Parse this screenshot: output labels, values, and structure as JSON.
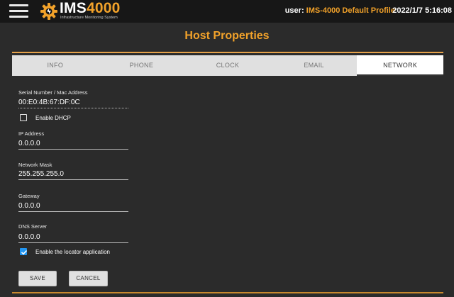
{
  "header": {
    "logo_brand": "IMS",
    "logo_number": "4000",
    "logo_subtitle": "Infrastructure Monitoring System",
    "user_label": "user:",
    "user_value": "IMS-4000 Default Profile",
    "datetime": "2022/1/7 5:16:08",
    "brand_color": "#f2a22a"
  },
  "page": {
    "title": "Host Properties"
  },
  "tabs": [
    {
      "label": "INFO",
      "active": false
    },
    {
      "label": "PHONE",
      "active": false
    },
    {
      "label": "CLOCK",
      "active": false
    },
    {
      "label": "EMAIL",
      "active": false
    },
    {
      "label": "NETWORK",
      "active": true
    }
  ],
  "form": {
    "serial": {
      "label": "Serial Number / Mac Address",
      "value": "00:E0:4B:67:DF:0C"
    },
    "dhcp": {
      "label": "Enable DHCP",
      "checked": false
    },
    "ip": {
      "label": "IP Address",
      "value": "0.0.0.0"
    },
    "mask": {
      "label": "Network Mask",
      "value": "255.255.255.0"
    },
    "gateway": {
      "label": "Gateway",
      "value": "0.0.0.0"
    },
    "dns": {
      "label": "DNS Server",
      "value": "0.0.0.0"
    },
    "locator": {
      "label": "Enable the locator application",
      "checked": true
    }
  },
  "buttons": {
    "save": "SAVE",
    "cancel": "CANCEL"
  },
  "icons": {
    "menu": "hamburger-menu-icon",
    "logo": "ims-gear-logo-icon",
    "check": "checkmark-icon"
  }
}
